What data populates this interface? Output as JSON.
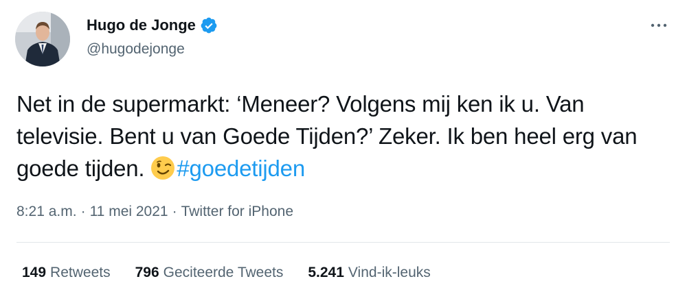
{
  "author": {
    "display_name": "Hugo de Jonge",
    "handle": "@hugodejonge",
    "verified": true,
    "verified_color": "#1d9bf0"
  },
  "tweet": {
    "text_part1": "Net in de supermarkt: ‘Meneer? Volgens mij ken ik u. Van televisie. Bent u van Goede Tijden?’ Zeker. Ik ben heel erg van goede tijden.",
    "emoji": "winking-face",
    "hashtag": "#goedetijden",
    "hashtag_color": "#1d9bf0"
  },
  "meta": {
    "time": "8:21 a.m.",
    "separator1": "·",
    "date": "11 mei 2021",
    "separator2": "·",
    "source": "Twitter for iPhone"
  },
  "stats": [
    {
      "count": "149",
      "label": "Retweets"
    },
    {
      "count": "796",
      "label": "Geciteerde Tweets"
    },
    {
      "count": "5.241",
      "label": "Vind-ik-leuks"
    }
  ],
  "icons": {
    "more": "more-horizontal-icon",
    "verified": "verified-badge-icon"
  }
}
